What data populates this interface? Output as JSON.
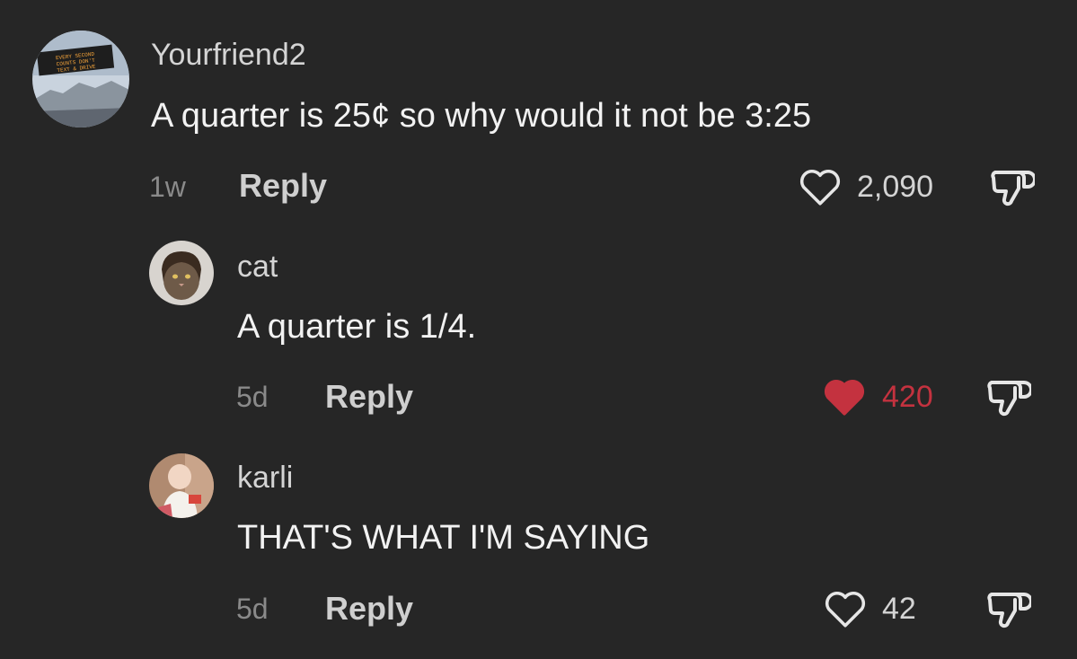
{
  "comments": [
    {
      "username": "Yourfriend2",
      "text": "A quarter is 25¢ so why would it not be 3:25",
      "time": "1w",
      "reply_label": "Reply",
      "likes": "2,090",
      "liked": false,
      "avatar_sign_text": "EVERY SECOND COUNTS DON'T TEXT & DRIVE"
    },
    {
      "username": "cat",
      "text": "A quarter is 1/4.",
      "time": "5d",
      "reply_label": "Reply",
      "likes": "420",
      "liked": true
    },
    {
      "username": "karli",
      "text": "THAT'S WHAT I'M SAYING",
      "time": "5d",
      "reply_label": "Reply",
      "likes": "42",
      "liked": false
    }
  ],
  "colors": {
    "background": "#262626",
    "liked_heart": "#c4323f",
    "text": "#f2f2f2",
    "muted": "#8a8a8a"
  },
  "icons": {
    "like": "heart-icon",
    "dislike": "thumbs-down-icon"
  }
}
